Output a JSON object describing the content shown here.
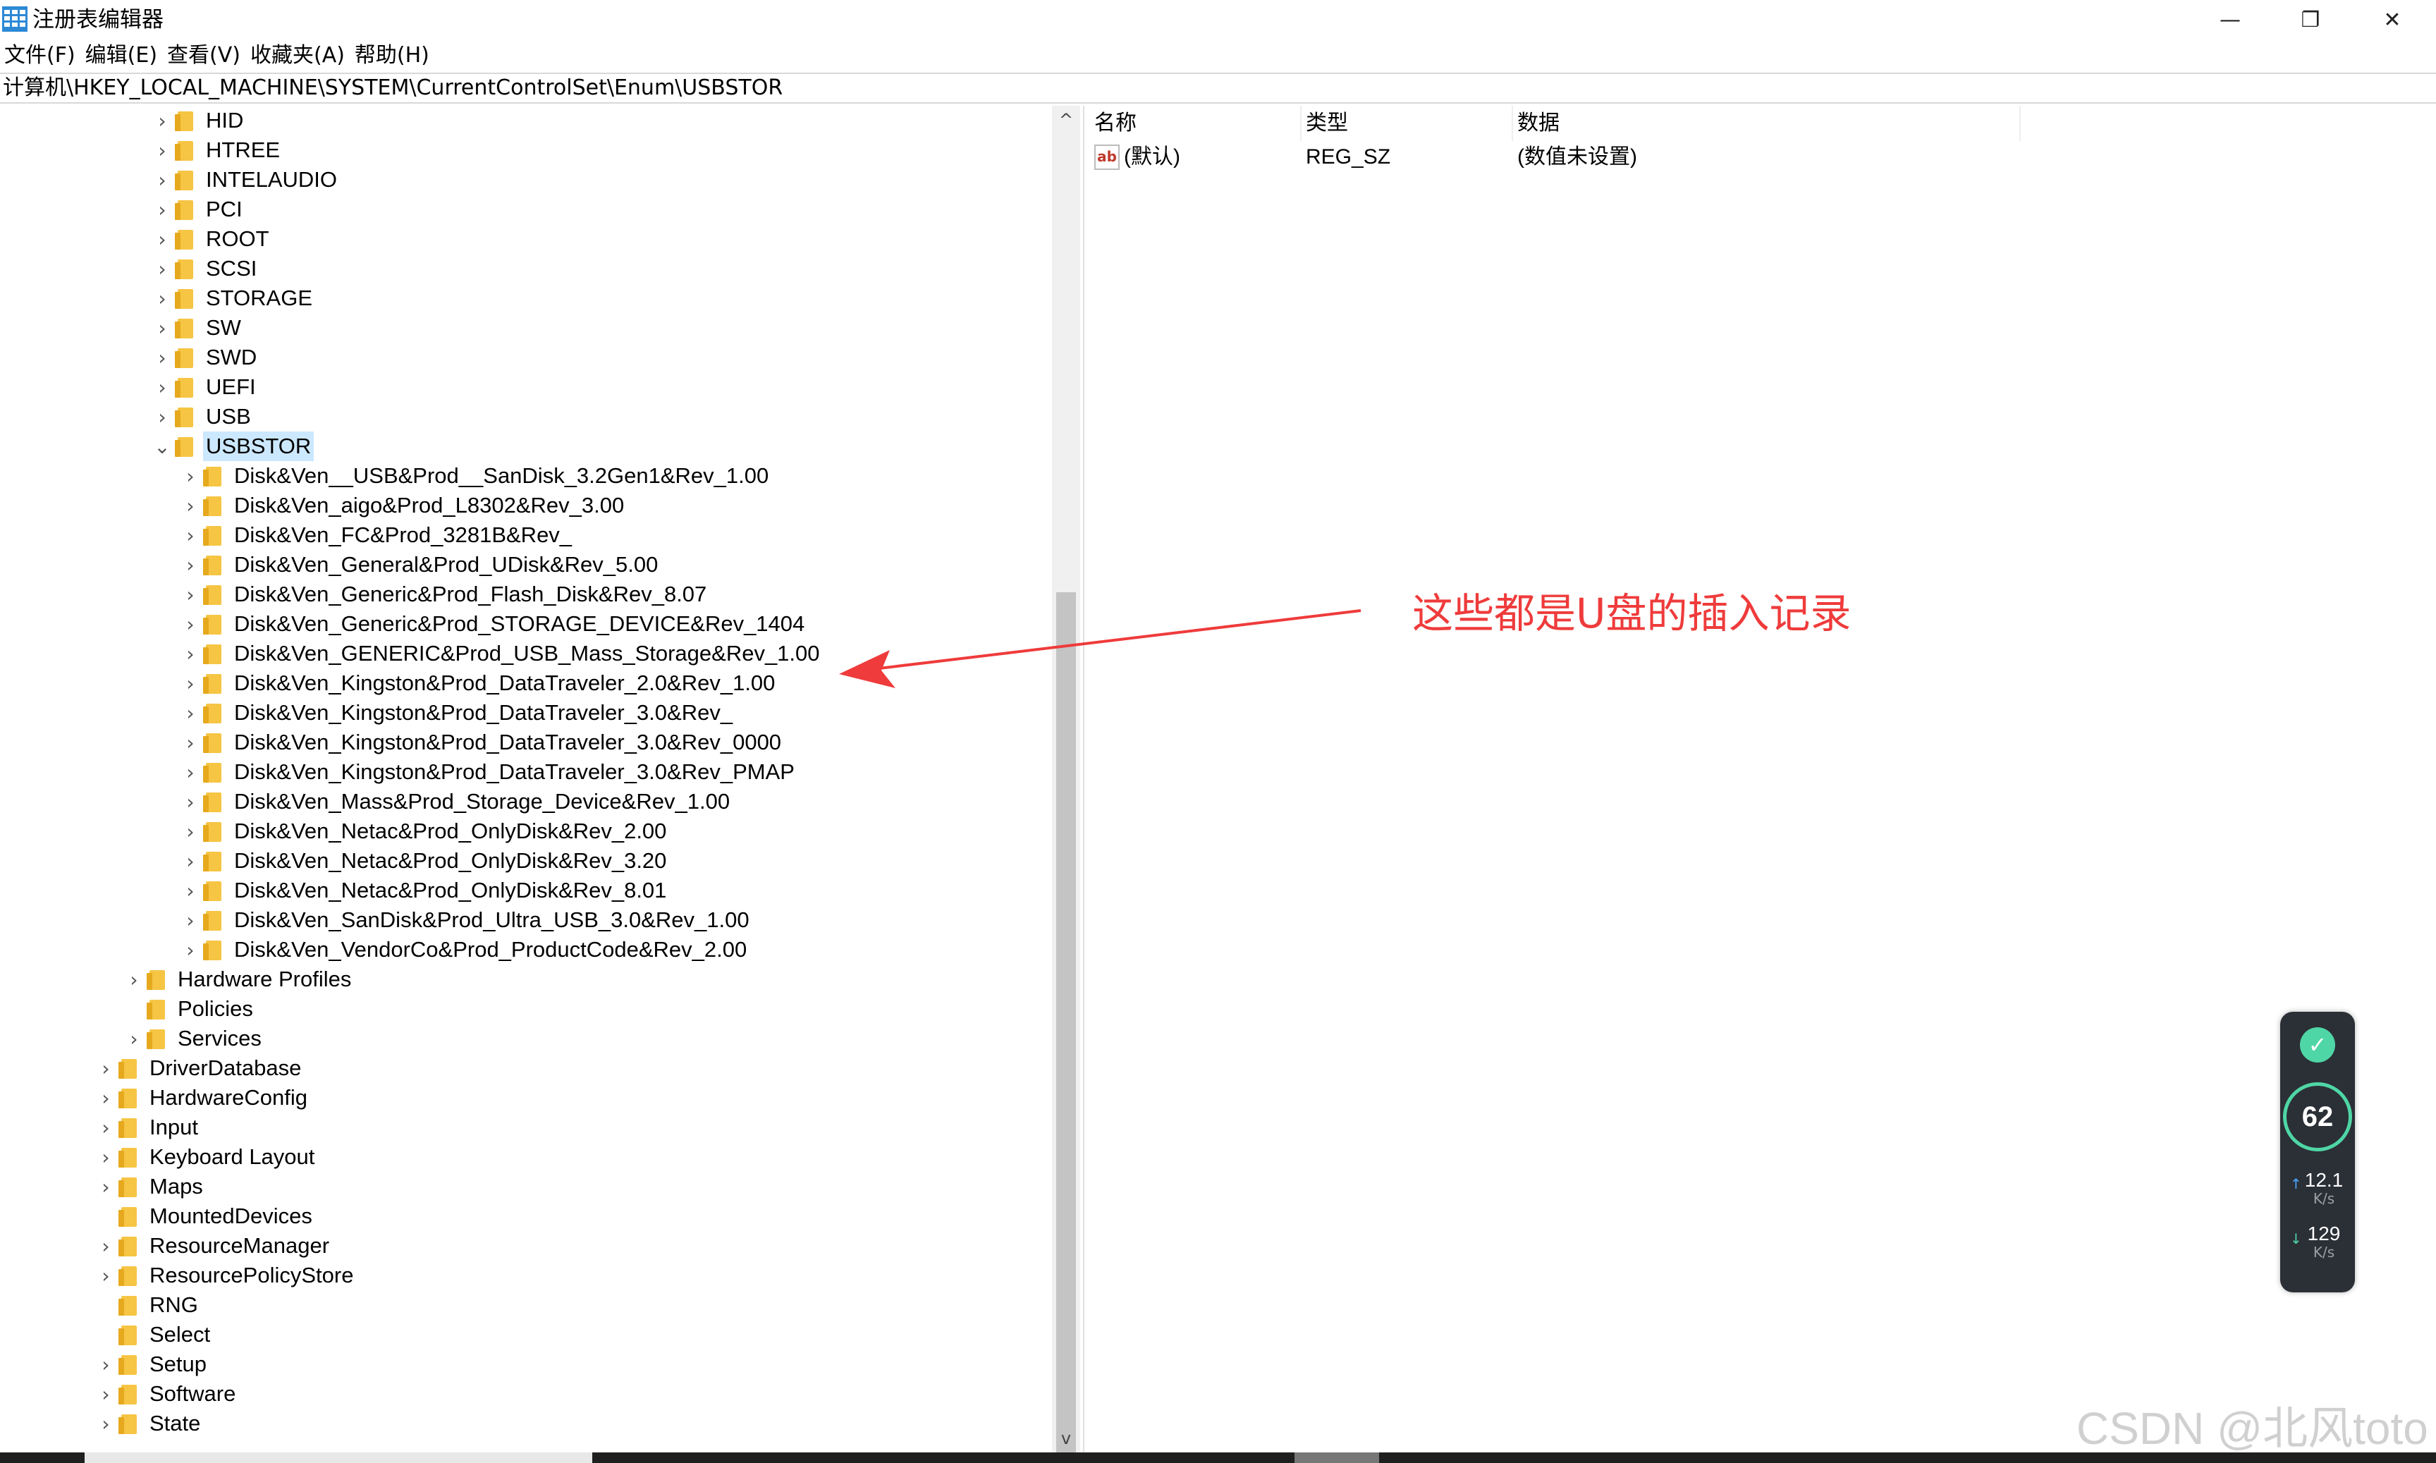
{
  "window": {
    "title": "注册表编辑器",
    "minimize_glyph": "—",
    "maximize_glyph": "❐",
    "close_glyph": "✕"
  },
  "menu": [
    "文件(F)",
    "编辑(E)",
    "查看(V)",
    "收藏夹(A)",
    "帮助(H)"
  ],
  "address": "计算机\\HKEY_LOCAL_MACHINE\\SYSTEM\\CurrentControlSet\\Enum\\USBSTOR",
  "tree": [
    {
      "label": "HID",
      "level": 2,
      "expander": "›"
    },
    {
      "label": "HTREE",
      "level": 2,
      "expander": "›"
    },
    {
      "label": "INTELAUDIO",
      "level": 2,
      "expander": "›"
    },
    {
      "label": "PCI",
      "level": 2,
      "expander": "›"
    },
    {
      "label": "ROOT",
      "level": 2,
      "expander": "›"
    },
    {
      "label": "SCSI",
      "level": 2,
      "expander": "›"
    },
    {
      "label": "STORAGE",
      "level": 2,
      "expander": "›"
    },
    {
      "label": "SW",
      "level": 2,
      "expander": "›"
    },
    {
      "label": "SWD",
      "level": 2,
      "expander": "›"
    },
    {
      "label": "UEFI",
      "level": 2,
      "expander": "›"
    },
    {
      "label": "USB",
      "level": 2,
      "expander": "›"
    },
    {
      "label": "USBSTOR",
      "level": 2,
      "expander": "⌄",
      "selected": true
    },
    {
      "label": "Disk&Ven__USB&Prod__SanDisk_3.2Gen1&Rev_1.00",
      "level": 3,
      "expander": "›"
    },
    {
      "label": "Disk&Ven_aigo&Prod_L8302&Rev_3.00",
      "level": 3,
      "expander": "›"
    },
    {
      "label": "Disk&Ven_FC&Prod_3281B&Rev_",
      "level": 3,
      "expander": "›"
    },
    {
      "label": "Disk&Ven_General&Prod_UDisk&Rev_5.00",
      "level": 3,
      "expander": "›"
    },
    {
      "label": "Disk&Ven_Generic&Prod_Flash_Disk&Rev_8.07",
      "level": 3,
      "expander": "›"
    },
    {
      "label": "Disk&Ven_Generic&Prod_STORAGE_DEVICE&Rev_1404",
      "level": 3,
      "expander": "›"
    },
    {
      "label": "Disk&Ven_GENERIC&Prod_USB_Mass_Storage&Rev_1.00",
      "level": 3,
      "expander": "›"
    },
    {
      "label": "Disk&Ven_Kingston&Prod_DataTraveler_2.0&Rev_1.00",
      "level": 3,
      "expander": "›"
    },
    {
      "label": "Disk&Ven_Kingston&Prod_DataTraveler_3.0&Rev_",
      "level": 3,
      "expander": "›"
    },
    {
      "label": "Disk&Ven_Kingston&Prod_DataTraveler_3.0&Rev_0000",
      "level": 3,
      "expander": "›"
    },
    {
      "label": "Disk&Ven_Kingston&Prod_DataTraveler_3.0&Rev_PMAP",
      "level": 3,
      "expander": "›"
    },
    {
      "label": "Disk&Ven_Mass&Prod_Storage_Device&Rev_1.00",
      "level": 3,
      "expander": "›"
    },
    {
      "label": "Disk&Ven_Netac&Prod_OnlyDisk&Rev_2.00",
      "level": 3,
      "expander": "›"
    },
    {
      "label": "Disk&Ven_Netac&Prod_OnlyDisk&Rev_3.20",
      "level": 3,
      "expander": "›"
    },
    {
      "label": "Disk&Ven_Netac&Prod_OnlyDisk&Rev_8.01",
      "level": 3,
      "expander": "›"
    },
    {
      "label": "Disk&Ven_SanDisk&Prod_Ultra_USB_3.0&Rev_1.00",
      "level": 3,
      "expander": "›"
    },
    {
      "label": "Disk&Ven_VendorCo&Prod_ProductCode&Rev_2.00",
      "level": 3,
      "expander": "›"
    },
    {
      "label": "Hardware Profiles",
      "level": 1,
      "expander": "›"
    },
    {
      "label": "Policies",
      "level": 1,
      "expander": ""
    },
    {
      "label": "Services",
      "level": 1,
      "expander": "›"
    },
    {
      "label": "DriverDatabase",
      "level": 0,
      "expander": "›"
    },
    {
      "label": "HardwareConfig",
      "level": 0,
      "expander": "›"
    },
    {
      "label": "Input",
      "level": 0,
      "expander": "›"
    },
    {
      "label": "Keyboard Layout",
      "level": 0,
      "expander": "›"
    },
    {
      "label": "Maps",
      "level": 0,
      "expander": "›"
    },
    {
      "label": "MountedDevices",
      "level": 0,
      "expander": ""
    },
    {
      "label": "ResourceManager",
      "level": 0,
      "expander": "›"
    },
    {
      "label": "ResourcePolicyStore",
      "level": 0,
      "expander": "›"
    },
    {
      "label": "RNG",
      "level": 0,
      "expander": ""
    },
    {
      "label": "Select",
      "level": 0,
      "expander": ""
    },
    {
      "label": "Setup",
      "level": 0,
      "expander": "›"
    },
    {
      "label": "Software",
      "level": 0,
      "expander": "›"
    },
    {
      "label": "State",
      "level": 0,
      "expander": "›"
    }
  ],
  "list": {
    "headers": [
      "名称",
      "类型",
      "数据"
    ],
    "rows": [
      {
        "icon": "ab",
        "name": "(默认)",
        "type": "REG_SZ",
        "data": "(数值未设置)"
      }
    ]
  },
  "annotation": "这些都是U盘的插入记录",
  "annotation_color": "#ef3b3b",
  "widget": {
    "score": "62",
    "upload": "12.1",
    "upload_unit": "K/s",
    "download": "129",
    "download_unit": "K/s",
    "check_glyph": "✓",
    "up_glyph": "↑",
    "down_glyph": "↓"
  },
  "watermark": "CSDN @北风toto",
  "scroll": {
    "up": "^",
    "down": "v"
  }
}
